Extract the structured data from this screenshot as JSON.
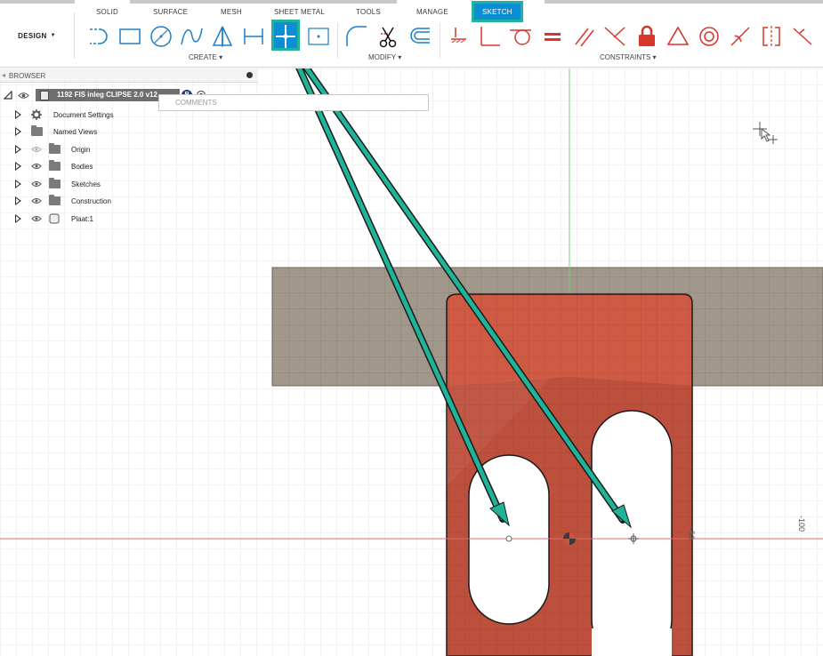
{
  "tabs": [
    {
      "label": "SOLID",
      "active": false
    },
    {
      "label": "SURFACE",
      "active": false
    },
    {
      "label": "MESH",
      "active": false
    },
    {
      "label": "SHEET METAL",
      "active": false
    },
    {
      "label": "TOOLS",
      "active": false
    },
    {
      "label": "MANAGE",
      "active": false
    },
    {
      "label": "SKETCH",
      "active": true
    }
  ],
  "workspace": {
    "label": "DESIGN"
  },
  "groups": {
    "create": "CREATE ▾",
    "modify": "MODIFY ▾",
    "constraints": "CONSTRAINTS ▾"
  },
  "browser": {
    "title": "BROWSER",
    "root": "1192 FIS inleg CLIPSE 2.0 v12",
    "comments_placeholder": "COMMENTS",
    "items": [
      {
        "label": "Document Settings",
        "icon": "gear-icon"
      },
      {
        "label": "Named Views",
        "icon": "folder-icon"
      },
      {
        "label": "Origin",
        "icon": "folder-icon"
      },
      {
        "label": "Bodies",
        "icon": "folder-icon"
      },
      {
        "label": "Sketches",
        "icon": "folder-icon"
      },
      {
        "label": "Construction",
        "icon": "folder-icon"
      },
      {
        "label": "Plaat:1",
        "icon": "component-icon"
      }
    ]
  },
  "canvas": {
    "dim_minus50": "-50",
    "dim_minus100": "-100"
  },
  "colors": {
    "accent_blue": "#0a8fd6",
    "highlight_teal": "#22b39a",
    "constraint_red": "#d9362b",
    "sketch_body": "#c95441",
    "beam_fill": "#a1978a"
  }
}
